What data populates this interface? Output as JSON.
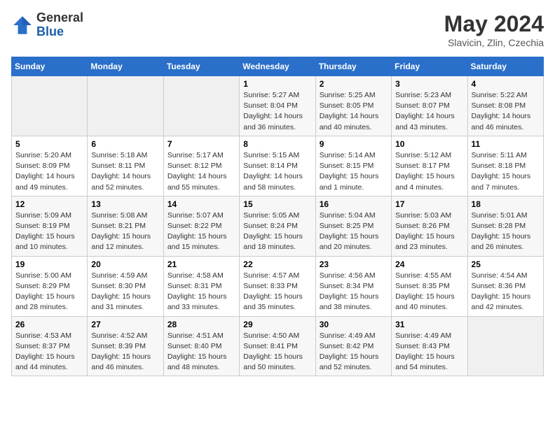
{
  "header": {
    "logo_general": "General",
    "logo_blue": "Blue",
    "month_year": "May 2024",
    "location": "Slavicin, Zlin, Czechia"
  },
  "weekdays": [
    "Sunday",
    "Monday",
    "Tuesday",
    "Wednesday",
    "Thursday",
    "Friday",
    "Saturday"
  ],
  "weeks": [
    [
      {
        "day": "",
        "info": ""
      },
      {
        "day": "",
        "info": ""
      },
      {
        "day": "",
        "info": ""
      },
      {
        "day": "1",
        "info": "Sunrise: 5:27 AM\nSunset: 8:04 PM\nDaylight: 14 hours\nand 36 minutes."
      },
      {
        "day": "2",
        "info": "Sunrise: 5:25 AM\nSunset: 8:05 PM\nDaylight: 14 hours\nand 40 minutes."
      },
      {
        "day": "3",
        "info": "Sunrise: 5:23 AM\nSunset: 8:07 PM\nDaylight: 14 hours\nand 43 minutes."
      },
      {
        "day": "4",
        "info": "Sunrise: 5:22 AM\nSunset: 8:08 PM\nDaylight: 14 hours\nand 46 minutes."
      }
    ],
    [
      {
        "day": "5",
        "info": "Sunrise: 5:20 AM\nSunset: 8:09 PM\nDaylight: 14 hours\nand 49 minutes."
      },
      {
        "day": "6",
        "info": "Sunrise: 5:18 AM\nSunset: 8:11 PM\nDaylight: 14 hours\nand 52 minutes."
      },
      {
        "day": "7",
        "info": "Sunrise: 5:17 AM\nSunset: 8:12 PM\nDaylight: 14 hours\nand 55 minutes."
      },
      {
        "day": "8",
        "info": "Sunrise: 5:15 AM\nSunset: 8:14 PM\nDaylight: 14 hours\nand 58 minutes."
      },
      {
        "day": "9",
        "info": "Sunrise: 5:14 AM\nSunset: 8:15 PM\nDaylight: 15 hours\nand 1 minute."
      },
      {
        "day": "10",
        "info": "Sunrise: 5:12 AM\nSunset: 8:17 PM\nDaylight: 15 hours\nand 4 minutes."
      },
      {
        "day": "11",
        "info": "Sunrise: 5:11 AM\nSunset: 8:18 PM\nDaylight: 15 hours\nand 7 minutes."
      }
    ],
    [
      {
        "day": "12",
        "info": "Sunrise: 5:09 AM\nSunset: 8:19 PM\nDaylight: 15 hours\nand 10 minutes."
      },
      {
        "day": "13",
        "info": "Sunrise: 5:08 AM\nSunset: 8:21 PM\nDaylight: 15 hours\nand 12 minutes."
      },
      {
        "day": "14",
        "info": "Sunrise: 5:07 AM\nSunset: 8:22 PM\nDaylight: 15 hours\nand 15 minutes."
      },
      {
        "day": "15",
        "info": "Sunrise: 5:05 AM\nSunset: 8:24 PM\nDaylight: 15 hours\nand 18 minutes."
      },
      {
        "day": "16",
        "info": "Sunrise: 5:04 AM\nSunset: 8:25 PM\nDaylight: 15 hours\nand 20 minutes."
      },
      {
        "day": "17",
        "info": "Sunrise: 5:03 AM\nSunset: 8:26 PM\nDaylight: 15 hours\nand 23 minutes."
      },
      {
        "day": "18",
        "info": "Sunrise: 5:01 AM\nSunset: 8:28 PM\nDaylight: 15 hours\nand 26 minutes."
      }
    ],
    [
      {
        "day": "19",
        "info": "Sunrise: 5:00 AM\nSunset: 8:29 PM\nDaylight: 15 hours\nand 28 minutes."
      },
      {
        "day": "20",
        "info": "Sunrise: 4:59 AM\nSunset: 8:30 PM\nDaylight: 15 hours\nand 31 minutes."
      },
      {
        "day": "21",
        "info": "Sunrise: 4:58 AM\nSunset: 8:31 PM\nDaylight: 15 hours\nand 33 minutes."
      },
      {
        "day": "22",
        "info": "Sunrise: 4:57 AM\nSunset: 8:33 PM\nDaylight: 15 hours\nand 35 minutes."
      },
      {
        "day": "23",
        "info": "Sunrise: 4:56 AM\nSunset: 8:34 PM\nDaylight: 15 hours\nand 38 minutes."
      },
      {
        "day": "24",
        "info": "Sunrise: 4:55 AM\nSunset: 8:35 PM\nDaylight: 15 hours\nand 40 minutes."
      },
      {
        "day": "25",
        "info": "Sunrise: 4:54 AM\nSunset: 8:36 PM\nDaylight: 15 hours\nand 42 minutes."
      }
    ],
    [
      {
        "day": "26",
        "info": "Sunrise: 4:53 AM\nSunset: 8:37 PM\nDaylight: 15 hours\nand 44 minutes."
      },
      {
        "day": "27",
        "info": "Sunrise: 4:52 AM\nSunset: 8:39 PM\nDaylight: 15 hours\nand 46 minutes."
      },
      {
        "day": "28",
        "info": "Sunrise: 4:51 AM\nSunset: 8:40 PM\nDaylight: 15 hours\nand 48 minutes."
      },
      {
        "day": "29",
        "info": "Sunrise: 4:50 AM\nSunset: 8:41 PM\nDaylight: 15 hours\nand 50 minutes."
      },
      {
        "day": "30",
        "info": "Sunrise: 4:49 AM\nSunset: 8:42 PM\nDaylight: 15 hours\nand 52 minutes."
      },
      {
        "day": "31",
        "info": "Sunrise: 4:49 AM\nSunset: 8:43 PM\nDaylight: 15 hours\nand 54 minutes."
      },
      {
        "day": "",
        "info": ""
      }
    ]
  ]
}
